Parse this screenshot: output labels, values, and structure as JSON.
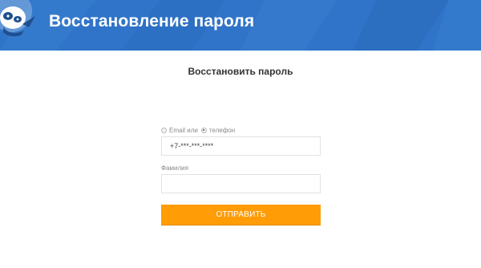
{
  "header": {
    "title": "Восстановление пароля",
    "background": "#2f74c8",
    "logo": "panda-mascot-icon"
  },
  "main": {
    "title": "Восстановить пароль"
  },
  "form": {
    "login_type": {
      "options": [
        {
          "label": "Email или",
          "selected": false
        },
        {
          "label": "телефон",
          "selected": true
        }
      ]
    },
    "phone_value": "+7-***-***-****",
    "lastname_label": "Фамилия",
    "lastname_value": "",
    "submit_label": "ОТПРАВИТЬ",
    "submit_color": "#ff9c06"
  }
}
